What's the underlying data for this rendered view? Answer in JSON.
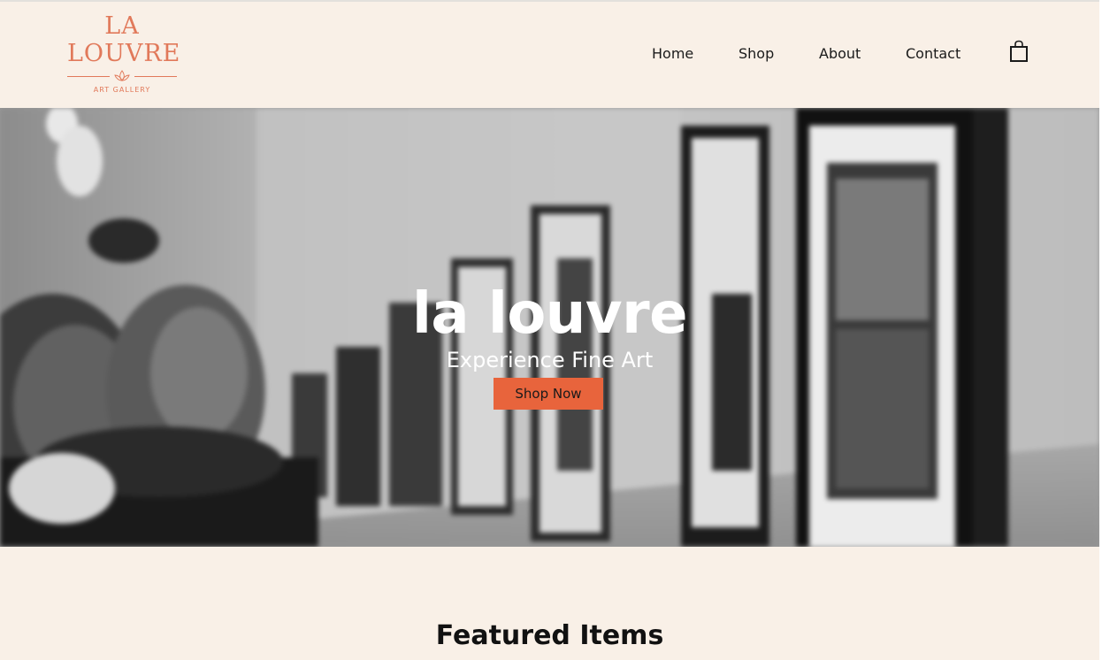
{
  "brand": {
    "logo_line1": "LA",
    "logo_line2": "LOUVRE",
    "logo_sub": "ART GALLERY",
    "accent_color": "#e1795a"
  },
  "nav": {
    "items": [
      {
        "label": "Home"
      },
      {
        "label": "Shop"
      },
      {
        "label": "About"
      },
      {
        "label": "Contact"
      }
    ],
    "cart_icon": "shopping-bag-icon"
  },
  "hero": {
    "title": "la louvre",
    "subtitle": "Experience Fine Art",
    "cta_label": "Shop Now",
    "cta_color": "#e8643c"
  },
  "featured": {
    "heading": "Featured Items"
  }
}
